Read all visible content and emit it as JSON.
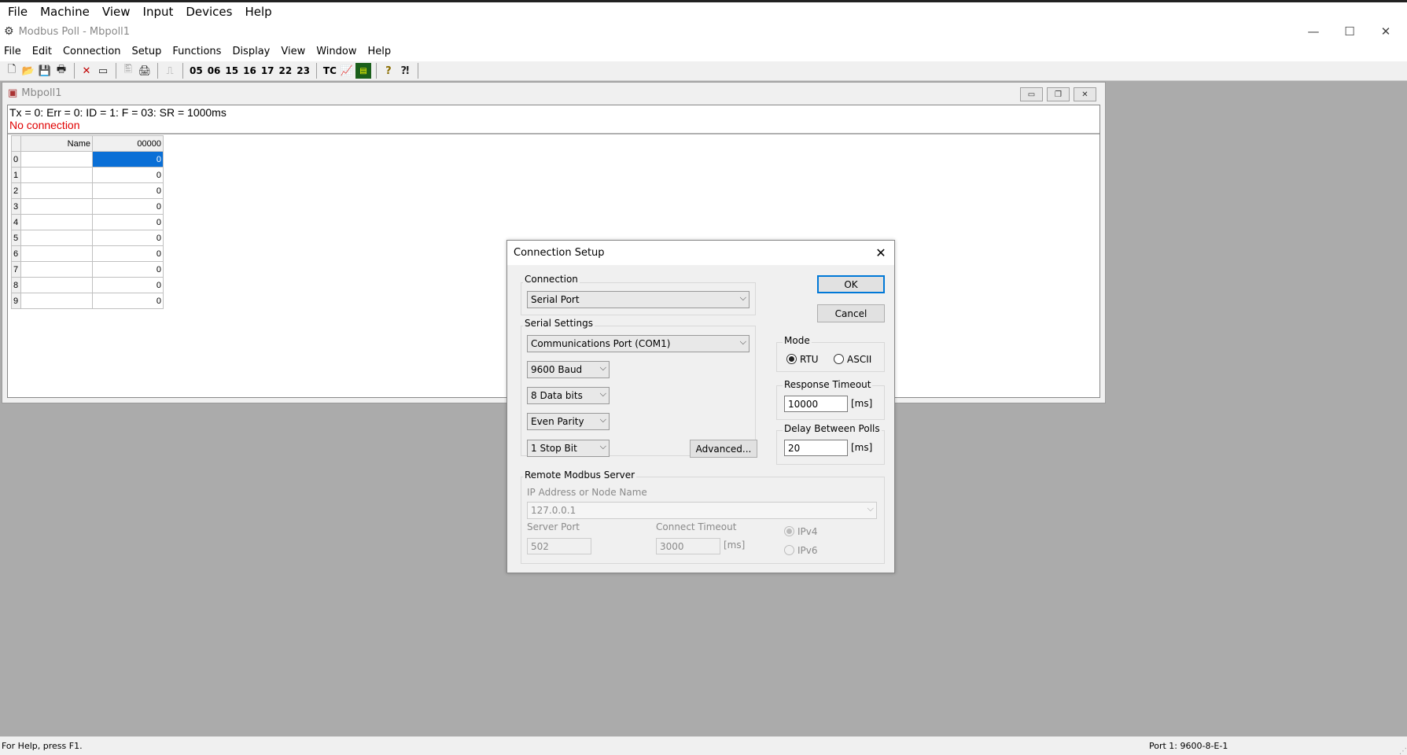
{
  "vm_menu": [
    "File",
    "Machine",
    "View",
    "Input",
    "Devices",
    "Help"
  ],
  "window": {
    "title": "Modbus Poll - Mbpoll1",
    "minimize": "—",
    "maximize": "☐",
    "close": "✕"
  },
  "app_menu": [
    "File",
    "Edit",
    "Connection",
    "Setup",
    "Functions",
    "Display",
    "View",
    "Window",
    "Help"
  ],
  "toolbar": {
    "codes": [
      "05",
      "06",
      "15",
      "16",
      "17",
      "22",
      "23"
    ],
    "tc": "TC"
  },
  "child": {
    "title": "Mbpoll1",
    "status_line": "Tx = 0: Err = 0: ID = 1: F = 03: SR = 1000ms",
    "connection_status": "No connection",
    "grid_name_header": "Name",
    "grid_value_header": "00000",
    "rows": [
      {
        "index": "0",
        "name": "",
        "value": "0"
      },
      {
        "index": "1",
        "name": "",
        "value": "0"
      },
      {
        "index": "2",
        "name": "",
        "value": "0"
      },
      {
        "index": "3",
        "name": "",
        "value": "0"
      },
      {
        "index": "4",
        "name": "",
        "value": "0"
      },
      {
        "index": "5",
        "name": "",
        "value": "0"
      },
      {
        "index": "6",
        "name": "",
        "value": "0"
      },
      {
        "index": "7",
        "name": "",
        "value": "0"
      },
      {
        "index": "8",
        "name": "",
        "value": "0"
      },
      {
        "index": "9",
        "name": "",
        "value": "0"
      }
    ]
  },
  "dialog": {
    "title": "Connection Setup",
    "connection_label": "Connection",
    "connection_value": "Serial Port",
    "serial_settings_label": "Serial Settings",
    "port_value": "Communications Port (COM1)",
    "baud_value": "9600 Baud",
    "data_bits_value": "8 Data bits",
    "parity_value": "Even Parity",
    "stop_bits_value": "1 Stop Bit",
    "advanced_button": "Advanced...",
    "ok_button": "OK",
    "cancel_button": "Cancel",
    "mode_label": "Mode",
    "mode_rtu": "RTU",
    "mode_ascii": "ASCII",
    "response_timeout_label": "Response Timeout",
    "response_timeout_value": "10000",
    "ms_unit": "[ms]",
    "delay_label": "Delay Between Polls",
    "delay_value": "20",
    "remote_label": "Remote Modbus Server",
    "ip_label": "IP Address or Node Name",
    "ip_value": "127.0.0.1",
    "server_port_label": "Server Port",
    "server_port_value": "502",
    "connect_timeout_label": "Connect Timeout",
    "connect_timeout_value": "3000",
    "ipv4": "IPv4",
    "ipv6": "IPv6"
  },
  "statusbar": {
    "help": "For Help, press F1.",
    "port": "Port 1: 9600-8-E-1"
  }
}
